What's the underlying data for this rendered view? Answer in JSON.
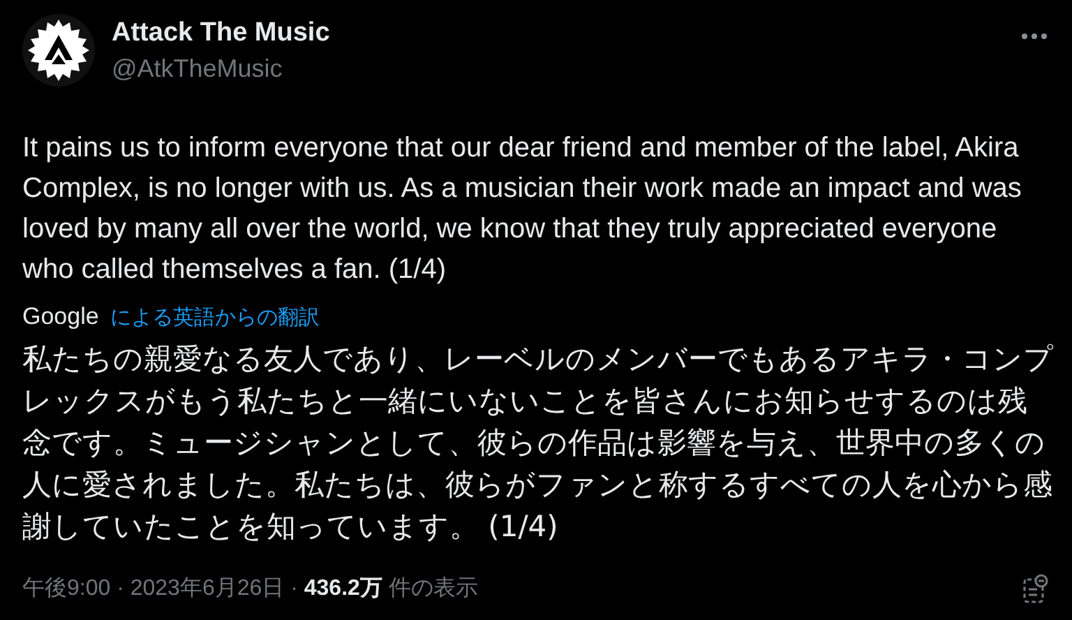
{
  "account": {
    "name": "Attack The Music",
    "handle": "@AtkTheMusic"
  },
  "post": {
    "text": "It pains us to inform everyone that our dear friend and member of the label, Akira Complex, is no longer with us. As a musician their work made an impact and was loved by many all over the world, we know that they truly appreciated everyone who called themselves a fan. (1/4)",
    "translation_source": "Google",
    "translation_label": "による英語からの翻訳",
    "translated_text": "私たちの親愛なる友人であり、レーベルのメンバーでもあるアキラ・コンプレックスがもう私たちと一緒にいないことを皆さんにお知らせするのは残念です。ミュージシャンとして、彼らの作品は影響を与え、世界中の多くの人に愛されました。私たちは、彼らがファンと称するすべての人を心から感謝していたことを知っています。 (1/4)",
    "meta": "午後9:00 · 2023年6月26日 · **436.2万** 件の表示"
  }
}
